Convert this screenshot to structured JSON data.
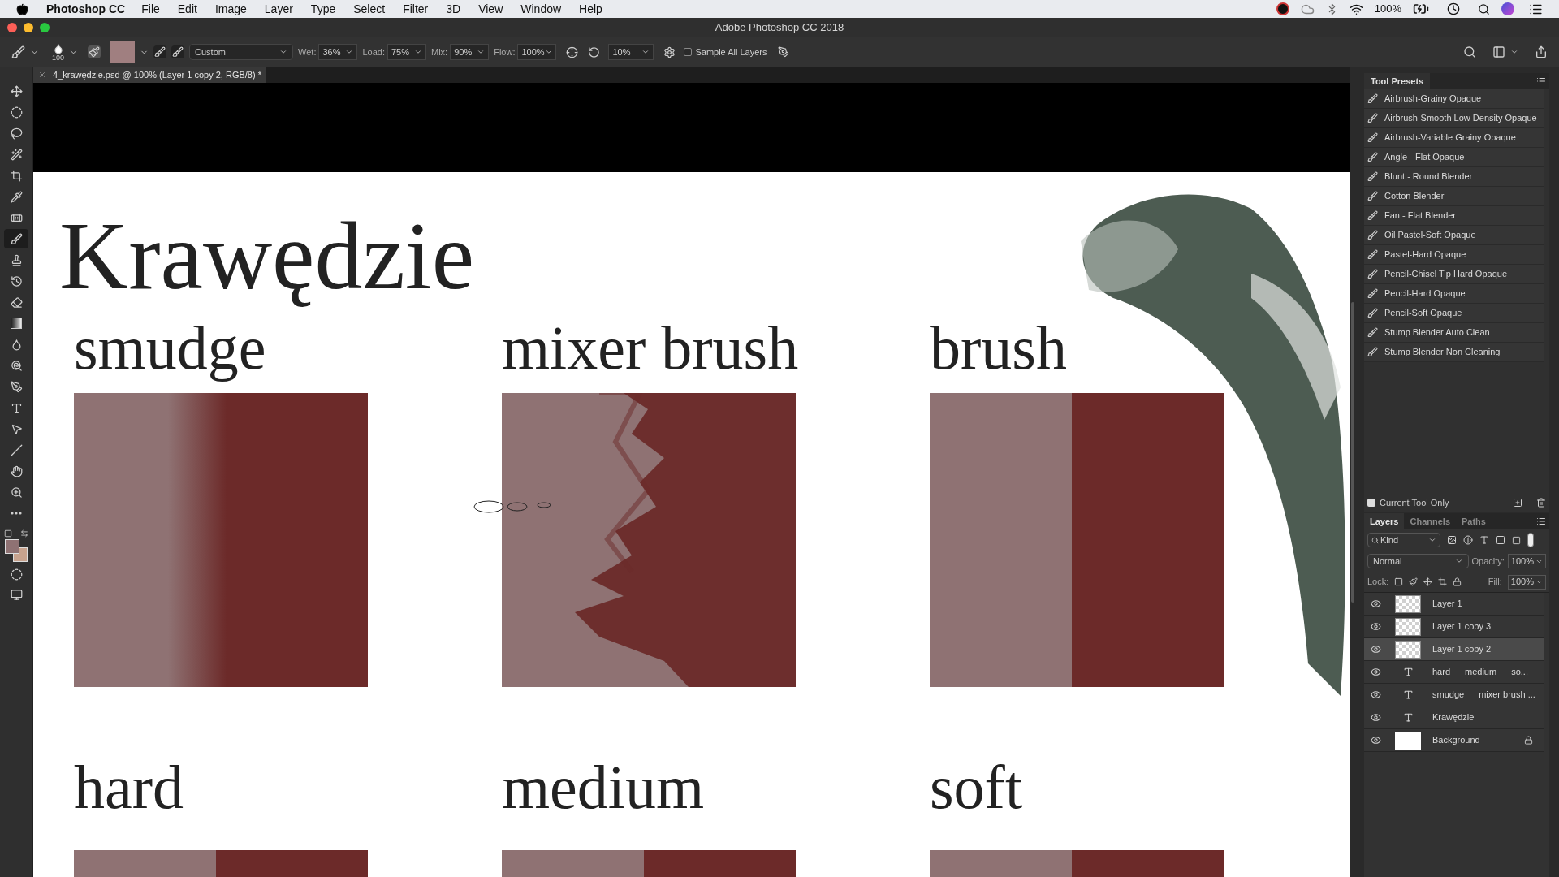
{
  "menu_bar": {
    "app": "Photoshop CC",
    "items": [
      "File",
      "Edit",
      "Image",
      "Layer",
      "Type",
      "Select",
      "Filter",
      "3D",
      "View",
      "Window",
      "Help"
    ],
    "battery": "100%"
  },
  "window": {
    "title": "Adobe Photoshop CC 2018"
  },
  "options_bar": {
    "brush_size": "100",
    "preset": "Custom",
    "fields": [
      {
        "label": "Wet:",
        "value": "36%"
      },
      {
        "label": "Load:",
        "value": "75%"
      },
      {
        "label": "Mix:",
        "value": "90%"
      },
      {
        "label": "Flow:",
        "value": "100%"
      }
    ],
    "smoothing": "10%",
    "sample_all_layers": {
      "label": "Sample All Layers",
      "checked": false
    }
  },
  "document_tab": {
    "title": "4_krawędzie.psd @ 100% (Layer 1 copy 2, RGB/8) *"
  },
  "toolbar": {
    "tools": [
      {
        "kind": "move",
        "selected": false
      },
      {
        "kind": "marquee",
        "selected": false
      },
      {
        "kind": "lasso",
        "selected": false
      },
      {
        "kind": "quick-select",
        "selected": false
      },
      {
        "kind": "crop",
        "selected": false
      },
      {
        "kind": "eyedropper",
        "selected": false
      },
      {
        "kind": "healing",
        "selected": false
      },
      {
        "kind": "brush",
        "selected": true
      },
      {
        "kind": "stamp",
        "selected": false
      },
      {
        "kind": "history",
        "selected": false
      },
      {
        "kind": "eraser",
        "selected": false
      },
      {
        "kind": "gradient",
        "selected": false
      },
      {
        "kind": "smudge",
        "selected": false
      },
      {
        "kind": "dodge",
        "selected": false
      },
      {
        "kind": "pen",
        "selected": false
      },
      {
        "kind": "type",
        "selected": false
      },
      {
        "kind": "path-select",
        "selected": false
      },
      {
        "kind": "line",
        "selected": false
      },
      {
        "kind": "hand",
        "selected": false
      },
      {
        "kind": "zoom",
        "selected": false
      },
      {
        "kind": "more",
        "selected": false
      }
    ]
  },
  "canvas": {
    "title": "Krawędzie",
    "rows": [
      {
        "cells": [
          {
            "label": "smudge",
            "kind": "smudge"
          },
          {
            "label": "mixer brush",
            "kind": "mixer"
          },
          {
            "label": "brush",
            "kind": "brush"
          }
        ]
      },
      {
        "cells": [
          {
            "label": "hard",
            "kind": "split"
          },
          {
            "label": "medium",
            "kind": "split"
          },
          {
            "label": "soft",
            "kind": "split"
          }
        ]
      }
    ]
  },
  "tool_presets": {
    "title": "Tool Presets",
    "items": [
      "Airbrush-Grainy Opaque",
      "Airbrush-Smooth Low Density Opaque",
      "Airbrush-Variable Grainy Opaque",
      "Angle - Flat Opaque",
      "Blunt - Round Blender",
      "Cotton Blender",
      "Fan - Flat Blender",
      "Oil Pastel-Soft Opaque",
      "Pastel-Hard Opaque",
      "Pencil-Chisel Tip Hard Opaque",
      "Pencil-Hard Opaque",
      "Pencil-Soft Opaque",
      "Stump Blender Auto Clean",
      "Stump Blender Non Cleaning"
    ],
    "current_tool_only": {
      "label": "Current Tool Only",
      "checked": true
    }
  },
  "layers_panel": {
    "tabs": [
      {
        "label": "Layers",
        "selected": true
      },
      {
        "label": "Channels",
        "selected": false
      },
      {
        "label": "Paths",
        "selected": false
      }
    ],
    "filter": "Kind",
    "blend_mode": "Normal",
    "opacity": {
      "label": "Opacity:",
      "value": "100%"
    },
    "lock_label": "Lock:",
    "fill": {
      "label": "Fill:",
      "value": "100%"
    },
    "layers": [
      {
        "name_parts": [
          "Layer 1"
        ],
        "kind": "pixel",
        "visible": true,
        "selected": false,
        "locked": false
      },
      {
        "name_parts": [
          "Layer 1 copy 3"
        ],
        "kind": "pixel",
        "visible": true,
        "selected": false,
        "locked": false
      },
      {
        "name_parts": [
          "Layer 1 copy 2"
        ],
        "kind": "pixel",
        "visible": true,
        "selected": true,
        "locked": false
      },
      {
        "name_parts": [
          "hard",
          "medium",
          "so..."
        ],
        "kind": "text",
        "visible": true,
        "selected": false,
        "locked": false
      },
      {
        "name_parts": [
          "smudge",
          "mixer brush ..."
        ],
        "kind": "text",
        "visible": true,
        "selected": false,
        "locked": false
      },
      {
        "name_parts": [
          "Krawędzie"
        ],
        "kind": "text",
        "visible": true,
        "selected": false,
        "locked": false
      },
      {
        "name_parts": [
          "Background"
        ],
        "kind": "fill",
        "visible": true,
        "selected": false,
        "locked": true
      }
    ]
  }
}
